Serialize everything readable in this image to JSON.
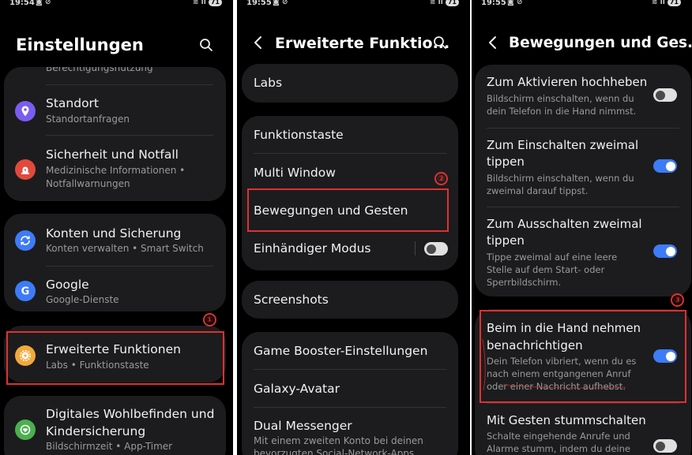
{
  "panel1": {
    "status": {
      "time": "19:54",
      "battery": "71"
    },
    "title": "Einstellungen",
    "partial_top_text": "Berechtigungsnutzung",
    "items": [
      {
        "title": "Standort",
        "subtitle": "Standortanfragen",
        "icon": "location-pin-icon",
        "color": "#7b5cf0"
      },
      {
        "title": "Sicherheit und Notfall",
        "subtitle": "Medizinische Informationen •",
        "subtitle2": "Notfallwarnungen",
        "icon": "emergency-siren-icon",
        "color": "#e04a3c"
      },
      {
        "title": "Konten und Sicherung",
        "subtitle": "Konten verwalten • Smart Switch",
        "icon": "sync-icon",
        "color": "#3e7bf6"
      },
      {
        "title": "Google",
        "subtitle": "Google-Dienste",
        "icon": "google-icon",
        "color": "#3e7bf6"
      },
      {
        "title": "Erweiterte Funktionen",
        "subtitle": "Labs • Funktionstaste",
        "icon": "gear-plus-icon",
        "color": "#f2a93b"
      },
      {
        "title": "Digitales Wohlbefinden und",
        "title2": "Kindersicherung",
        "subtitle": "Bildschirmzeit • App-Timer",
        "icon": "wellbeing-icon",
        "color": "#4caf50"
      }
    ],
    "badge": "①"
  },
  "panel2": {
    "status": {
      "time": "19:55",
      "battery": "71"
    },
    "title": "Erweiterte Funktio...",
    "items": {
      "labs": "Labs",
      "funktionstaste": "Funktionstaste",
      "multi_window": "Multi Window",
      "bewegungen": "Bewegungen und Gesten",
      "einhaendig": "Einhändiger Modus",
      "screenshots": "Screenshots",
      "game_booster": "Game Booster-Einstellungen",
      "galaxy_avatar": "Galaxy-Avatar",
      "dual_messenger": "Dual Messenger",
      "dual_messenger_sub": "Mit einem zweiten Konto bei deinen",
      "dual_messenger_sub2": "bevorzugten Social-Network-Apps"
    },
    "toggles": {
      "einhaendig": false
    },
    "badge": "②"
  },
  "panel3": {
    "status": {
      "time": "19:55",
      "battery": "71"
    },
    "title": "Bewegungen und Ges...",
    "items": [
      {
        "title": "Zum Aktivieren hochheben",
        "sub": [
          "Bildschirm einschalten, wenn du",
          "dein Telefon in die Hand nimmst."
        ],
        "on": false
      },
      {
        "title": "Zum Einschalten zweimal",
        "title2": "tippen",
        "sub": [
          "Bildschirm einschalten, wenn du",
          "zweimal darauf tippst."
        ],
        "on": true
      },
      {
        "title": "Zum Ausschalten zweimal",
        "title2": "tippen",
        "sub": [
          "Tippe zweimal auf eine leere",
          "Stelle auf dem Start- oder",
          "Sperrbildschirm."
        ],
        "on": true
      },
      {
        "title": "Beim in die Hand nehmen",
        "title2": "benachrichtigen",
        "sub": [
          "Dein Telefon vibriert, wenn du es",
          "nach einem entgangenen Anruf",
          "oder einer Nachricht aufhebst."
        ],
        "on": true
      },
      {
        "title": "Mit Gesten stummschalten",
        "sub": [
          "Schalte eingehende Anrufe und",
          "Alarme stumm, indem du deine"
        ],
        "on": false
      }
    ],
    "badge": "③"
  },
  "colors": {
    "accent": "#3e7bf6",
    "highlight": "#e03030",
    "card": "#1c1c1e"
  }
}
